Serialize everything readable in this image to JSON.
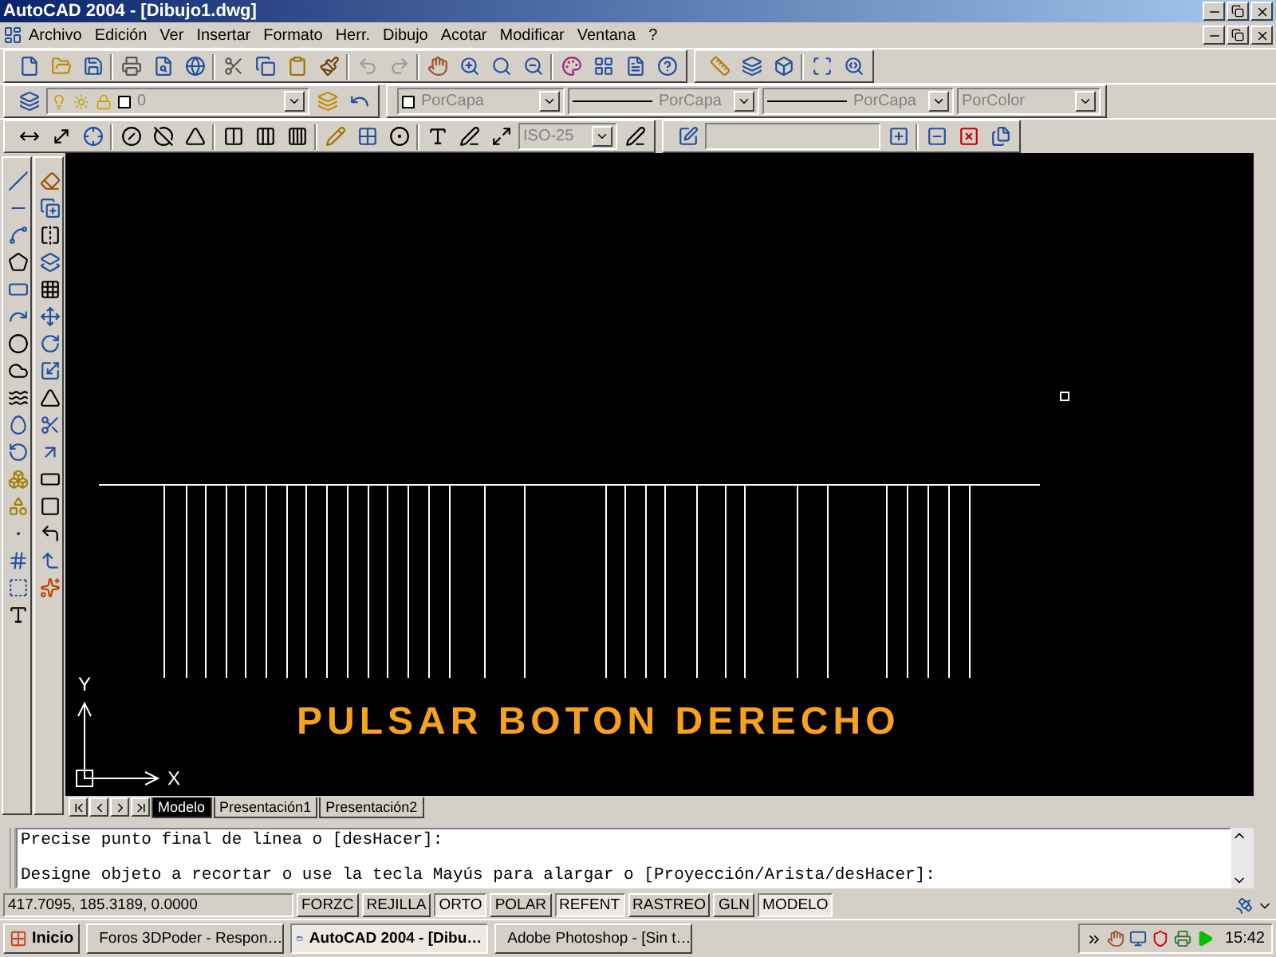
{
  "window": {
    "title": "AutoCAD 2004 - [Dibujo1.dwg]"
  },
  "menu": [
    "Archivo",
    "Edición",
    "Ver",
    "Insertar",
    "Formato",
    "Herr.",
    "Dibujo",
    "Acotar",
    "Modificar",
    "Ventana",
    "?"
  ],
  "properties": [
    {
      "kind": "layer",
      "value": "0"
    },
    {
      "kind": "color",
      "value": "PorCapa"
    },
    {
      "kind": "line",
      "value": "PorCapa"
    },
    {
      "kind": "line",
      "value": "PorCapa"
    },
    {
      "kind": "plain",
      "value": "PorColor"
    }
  ],
  "dim_style": {
    "value": "ISO-25"
  },
  "canvas": {
    "message": "PULSAR BOTON DERECHO",
    "axis_y": "Y",
    "axis_x": "X"
  },
  "tabs": [
    {
      "label": "Modelo",
      "selected": true
    },
    {
      "label": "Presentación1",
      "selected": false
    },
    {
      "label": "Presentación2",
      "selected": false
    }
  ],
  "command_lines": [
    "Precise punto final de línea o [desHacer]:",
    "Designe objeto a recortar o use la tecla Mayús para alargar o [Proyección/Arista/desHacer]:"
  ],
  "status_bar": {
    "coordinates": "417.7095, 185.3189, 0.0000",
    "toggles": [
      {
        "label": "FORZC",
        "on": false
      },
      {
        "label": "REJILLA",
        "on": false
      },
      {
        "label": "ORTO",
        "on": true
      },
      {
        "label": "POLAR",
        "on": false
      },
      {
        "label": "REFENT",
        "on": true
      },
      {
        "label": "RASTREO",
        "on": false
      },
      {
        "label": "GLN",
        "on": false
      },
      {
        "label": "MODELO",
        "on": true
      }
    ]
  },
  "taskbar": {
    "start": "Inicio",
    "tasks": [
      {
        "label": "Foros 3DPoder - Respon…",
        "selected": false
      },
      {
        "label": "AutoCAD 2004 - [Dibu…",
        "selected": true
      },
      {
        "label": "Adobe Photoshop - [Sin t…",
        "selected": false
      }
    ],
    "clock": "15:42"
  }
}
